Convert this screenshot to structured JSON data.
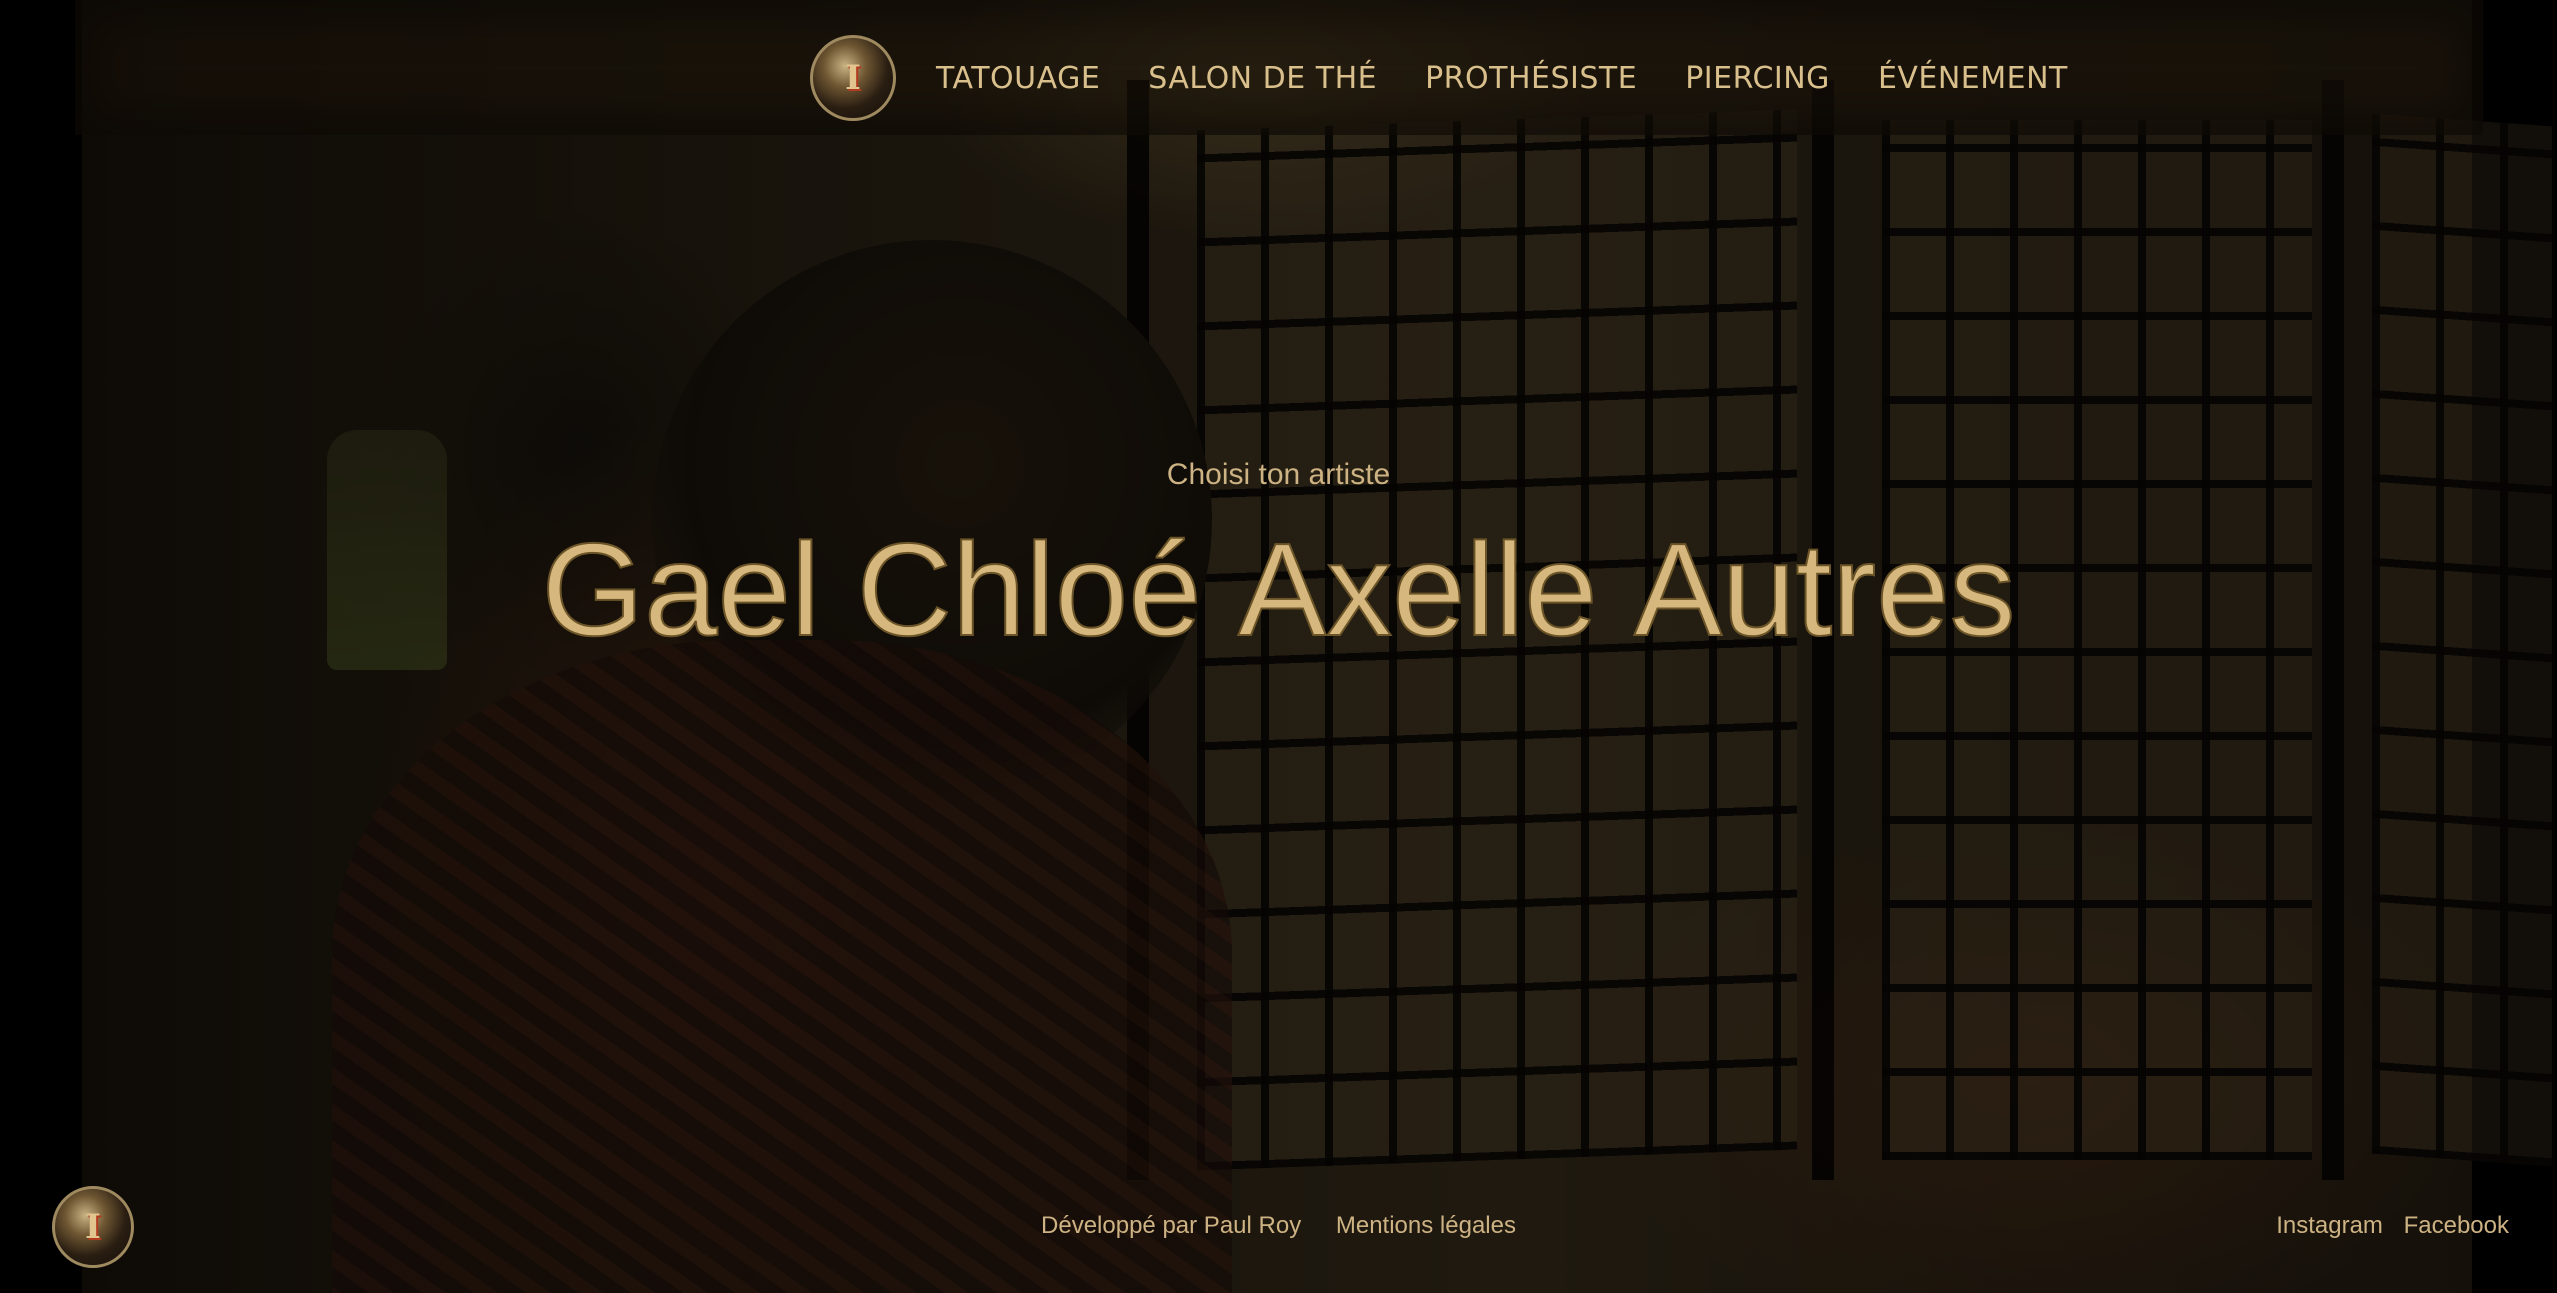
{
  "header": {
    "nav": [
      "TATOUAGE",
      "SALON DE THÉ",
      "PROTHÉSISTE",
      "PIERCING",
      "ÉVÉNEMENT"
    ]
  },
  "hero": {
    "tagline": "Choisi ton artiste",
    "artists": [
      "Gael",
      "Chloé",
      "Axelle",
      "Autres"
    ]
  },
  "footer": {
    "developer": "Développé par Paul Roy",
    "legal": "Mentions légales",
    "social": [
      "Instagram",
      "Facebook"
    ]
  },
  "colors": {
    "accent_gold": "#d6b87f",
    "background": "#000000"
  }
}
